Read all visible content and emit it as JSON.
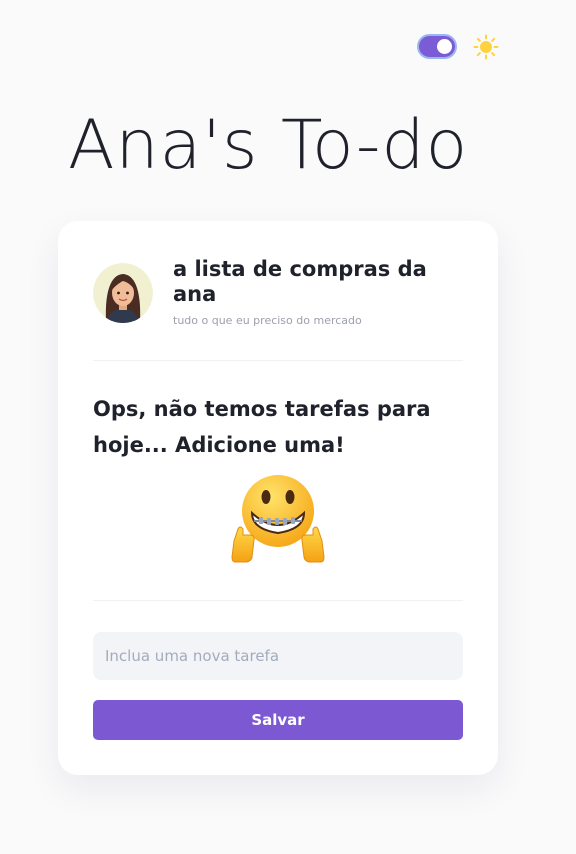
{
  "header": {
    "title": "Ana's To-do",
    "theme_toggle_on": true
  },
  "card": {
    "list_title": "a lista de compras da ana",
    "list_subtitle": "tudo o que eu preciso do mercado",
    "empty_message": "Ops, não temos tarefas para hoje... Adicione uma!",
    "input_placeholder": "Inclua uma nova tarefa",
    "input_value": "",
    "save_label": "Salvar"
  },
  "icons": {
    "theme_toggle": "toggle-switch",
    "theme": "sun-icon",
    "avatar": "avatar-woman",
    "empty_state": "grinning-thumbs-up-emoji"
  },
  "colors": {
    "accent": "#7c58d3",
    "toggle_border": "#9bb7f0",
    "sun": "#ffd23f",
    "background": "#fafafb",
    "card": "#ffffff",
    "input_background": "#f3f4f8",
    "text": "#20222b",
    "muted_text": "#9ca0ab"
  }
}
